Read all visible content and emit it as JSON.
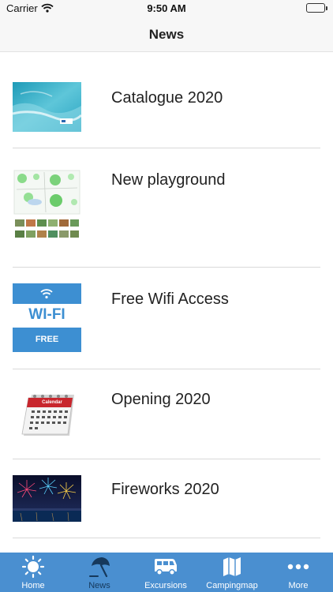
{
  "status_bar": {
    "carrier": "Carrier",
    "time": "9:50 AM"
  },
  "nav": {
    "title": "News"
  },
  "news_items": [
    {
      "title": "Catalogue 2020"
    },
    {
      "title": "New playground"
    },
    {
      "title": "Free Wifi Access",
      "thumb_text_1": "WI-FI",
      "thumb_text_2": "FREE"
    },
    {
      "title": "Opening 2020",
      "thumb_text_1": "Calendar"
    },
    {
      "title": "Fireworks 2020"
    }
  ],
  "tab_bar": {
    "items": [
      {
        "label": "Home",
        "icon": "sun-icon"
      },
      {
        "label": "News",
        "icon": "beach-umbrella-icon"
      },
      {
        "label": "Excursions",
        "icon": "camper-van-icon"
      },
      {
        "label": "Campingmap",
        "icon": "map-icon"
      },
      {
        "label": "More",
        "icon": "more-dots-icon"
      }
    ],
    "active": "News"
  },
  "colors": {
    "tab_bar": "#4a8fd0",
    "active_tab": "#16395c",
    "wifi_blue": "#3d8fd2"
  }
}
